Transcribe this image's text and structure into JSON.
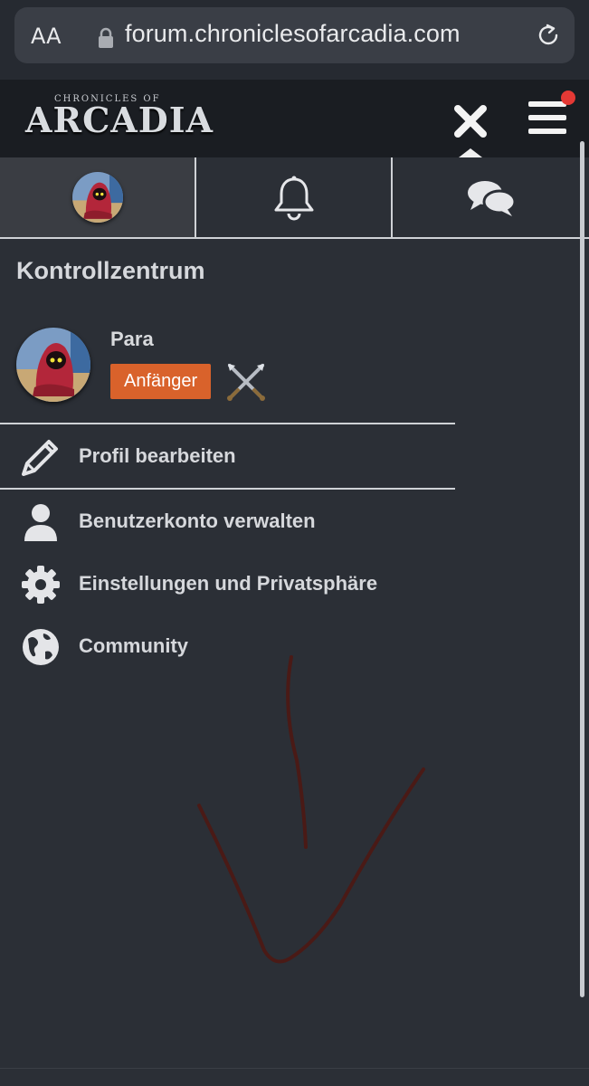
{
  "browser": {
    "aa_label": "AA",
    "url": "forum.chroniclesofarcadia.com"
  },
  "site": {
    "logo_small": "CHRONICLES OF",
    "logo_big": "ARCADIA"
  },
  "tabs": [
    {
      "name": "user",
      "icon": "avatar"
    },
    {
      "name": "notifications",
      "icon": "bell-icon"
    },
    {
      "name": "conversations",
      "icon": "chat-bubbles-icon"
    }
  ],
  "panel": {
    "title": "Kontrollzentrum",
    "user": {
      "name": "Para",
      "rank": "Anfänger",
      "rank_color": "#d9622b"
    },
    "menu": [
      {
        "label": "Profil bearbeiten",
        "icon": "pencil-icon"
      },
      {
        "label": "Benutzerkonto verwalten",
        "icon": "user-icon"
      },
      {
        "label": "Einstellungen und Privatsphäre",
        "icon": "gear-icon"
      },
      {
        "label": "Community",
        "icon": "globe-icon"
      }
    ]
  },
  "colors": {
    "background": "#2b2f36",
    "header": "#1a1d22",
    "notification": "#e53935",
    "annotation_arrow": "#4a1a16"
  }
}
